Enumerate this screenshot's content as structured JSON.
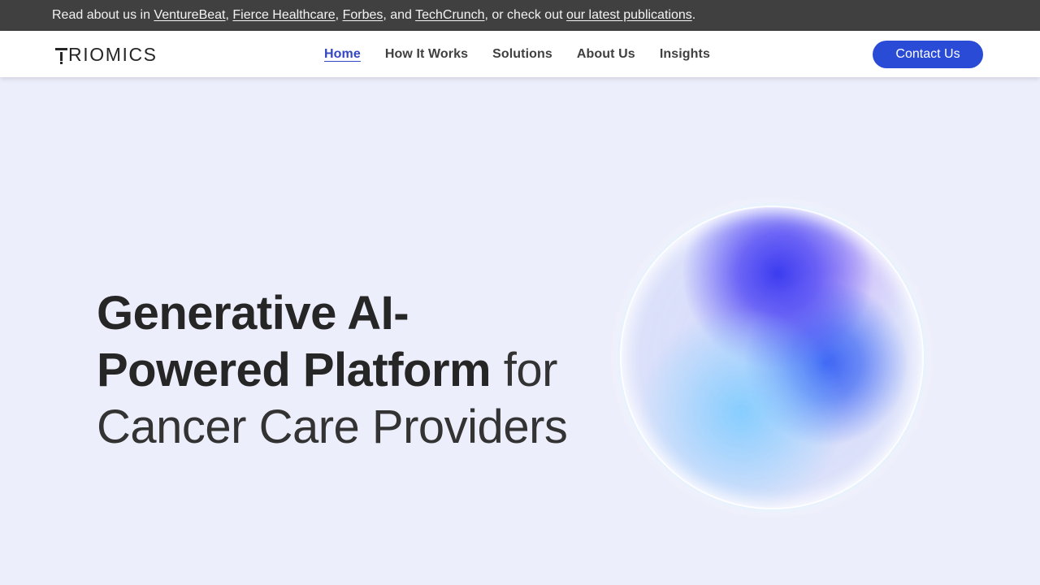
{
  "announcement": {
    "prefix": "Read about us in ",
    "links": [
      "VentureBeat",
      "Fierce Healthcare",
      "Forbes",
      "TechCrunch"
    ],
    "sep1": ", ",
    "sep2": ", ",
    "sep3": ", and ",
    "middle": ", or check out ",
    "publications_link": "our latest publications",
    "suffix": "."
  },
  "header": {
    "logo_rest": "RIOMICS",
    "logo_full": "TRIOMICS",
    "nav": [
      {
        "label": "Home",
        "active": true
      },
      {
        "label": "How It Works",
        "active": false
      },
      {
        "label": "Solutions",
        "active": false
      },
      {
        "label": "About Us",
        "active": false
      },
      {
        "label": "Insights",
        "active": false
      }
    ],
    "cta_label": "Contact Us"
  },
  "hero": {
    "line1": "Generative AI-",
    "line2_strong": "Powered Platform",
    "line2_light": " for",
    "line3": "Cancer Care Providers",
    "visual": "gradient-sphere"
  },
  "colors": {
    "announcement_bg": "#404040",
    "header_bg": "#ffffff",
    "page_bg": "#edeefb",
    "accent": "#2a4bd6",
    "active_nav": "#3447c0",
    "text": "#262626"
  }
}
